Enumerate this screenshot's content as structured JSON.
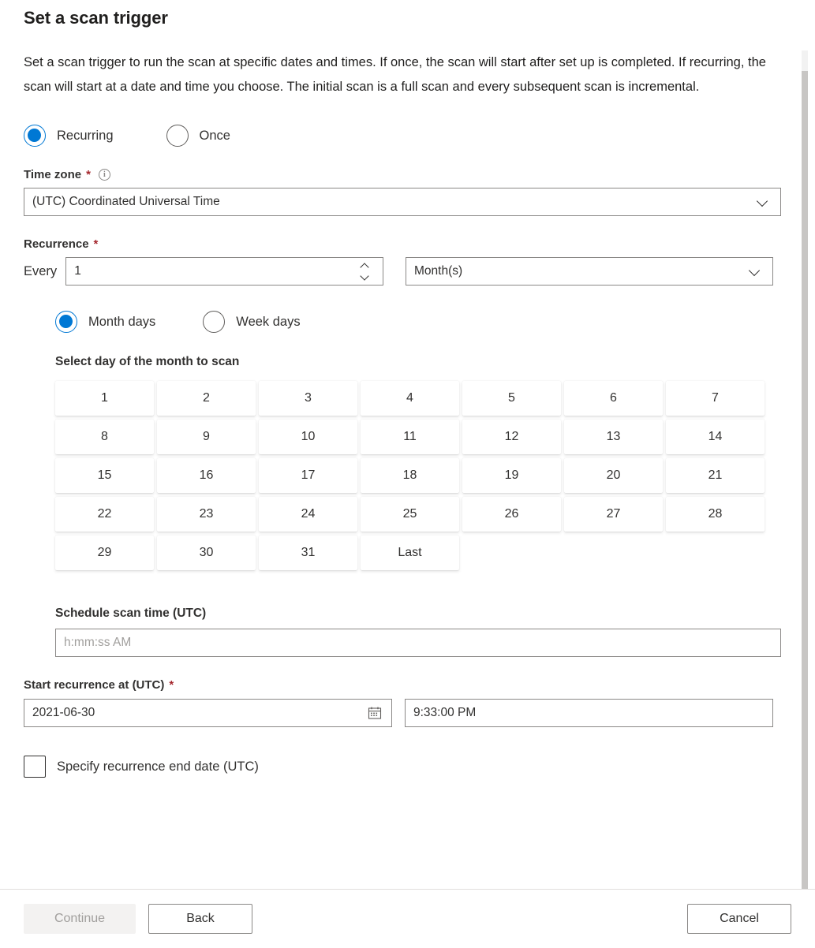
{
  "page": {
    "title": "Set a scan trigger",
    "description": "Set a scan trigger to run the scan at specific dates and times. If once, the scan will start after set up is completed. If recurring, the scan will start at a date and time you choose. The initial scan is a full scan and every subsequent scan is incremental."
  },
  "trigger_type": {
    "selected": "Recurring",
    "options": [
      {
        "label": "Recurring",
        "selected": true
      },
      {
        "label": "Once",
        "selected": false
      }
    ]
  },
  "time_zone": {
    "label": "Time zone",
    "required_marker": "*",
    "info_glyph": "i",
    "value": "(UTC) Coordinated Universal Time",
    "chevron": "chevron-down-icon"
  },
  "recurrence": {
    "label": "Recurrence",
    "required_marker": "*",
    "every_label": "Every",
    "interval_value": "1",
    "unit_value": "Month(s)",
    "mode": {
      "selected": "Month days",
      "options": [
        {
          "label": "Month days",
          "selected": true
        },
        {
          "label": "Week days",
          "selected": false
        }
      ]
    },
    "day_picker_label": "Select day of the month to scan",
    "days": [
      "1",
      "2",
      "3",
      "4",
      "5",
      "6",
      "7",
      "8",
      "9",
      "10",
      "11",
      "12",
      "13",
      "14",
      "15",
      "16",
      "17",
      "18",
      "19",
      "20",
      "21",
      "22",
      "23",
      "24",
      "25",
      "26",
      "27",
      "28",
      "29",
      "30",
      "31",
      "Last"
    ],
    "scan_time_label": "Schedule scan time (UTC)",
    "scan_time_placeholder": "h:mm:ss AM"
  },
  "start_recurrence": {
    "label": "Start recurrence at (UTC)",
    "required_marker": "*",
    "date_value": "2021-06-30",
    "date_icon": "calendar-icon",
    "time_value": "9:33:00 PM"
  },
  "end_date": {
    "label": "Specify recurrence end date (UTC)",
    "checked": false
  },
  "footer": {
    "continue_label": "Continue",
    "continue_disabled": true,
    "back_label": "Back",
    "cancel_label": "Cancel"
  },
  "colors": {
    "accent": "#0078d4",
    "required": "#a4262c",
    "text": "#323130",
    "border": "#8a8886",
    "disabled_bg": "#f3f2f1",
    "disabled_text": "#a19f9d",
    "scrollbar_thumb": "#c8c6c4",
    "scrollbar_track": "#f2f2f2"
  }
}
